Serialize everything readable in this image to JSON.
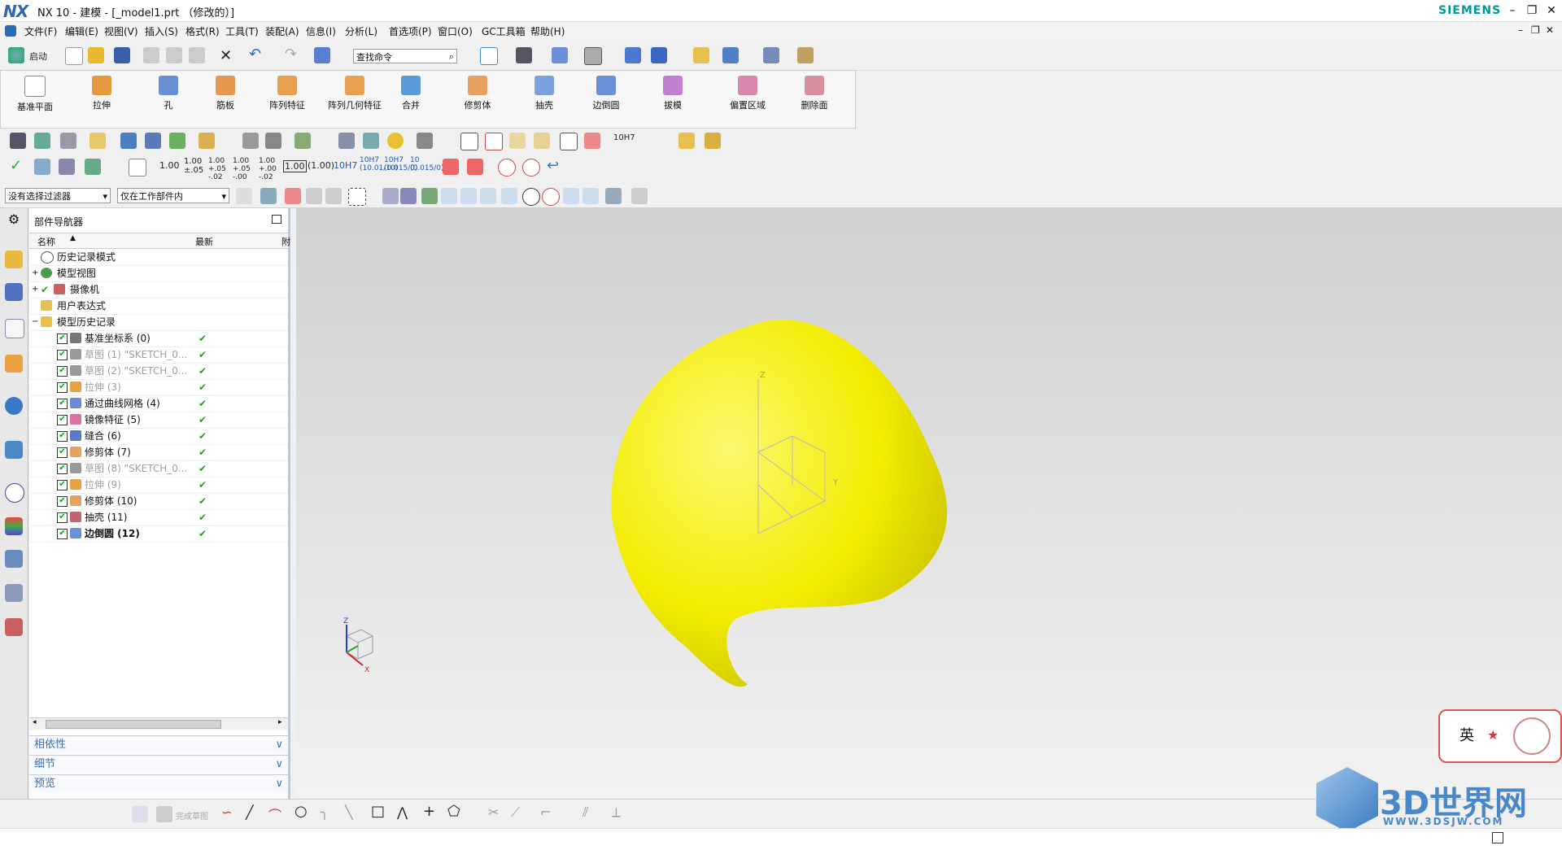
{
  "app": {
    "logo": "NX",
    "title": "NX 10 - 建模 - [_model1.prt （修改的）]",
    "brand": "SIEMENS"
  },
  "menu": [
    "文件(F)",
    "编辑(E)",
    "视图(V)",
    "插入(S)",
    "格式(R)",
    "工具(T)",
    "装配(A)",
    "信息(I)",
    "分析(L)",
    "首选项(P)",
    "窗口(O)",
    "GC工具箱",
    "帮助(H)"
  ],
  "toolbar": {
    "start_label": "启动",
    "search_placeholder": "查找命令"
  },
  "ribbon": [
    "基准平面",
    "拉伸",
    "孔",
    "筋板",
    "阵列特征",
    "阵列几何特征",
    "合并",
    "修剪体",
    "抽壳",
    "边倒圆",
    "拔模",
    "偏置区域",
    "删除面"
  ],
  "dimensions_row": [
    "1.00",
    "1.00 ±.05",
    "1.00 +.05 -.02",
    "1.00 +.05 -.00",
    "1.00 +.00 -.02",
    "1.00",
    "(1.00)",
    "10H7",
    "10H7 (10.01/10)",
    "10H7 (0.015/0)",
    "10 (0.015/0)"
  ],
  "fit_label": "10H7",
  "filters": {
    "selection_filter": "没有选择过滤器",
    "scope": "仅在工作部件内"
  },
  "navigator": {
    "title": "部件导航器",
    "col_name": "名称",
    "col_latest": "最新",
    "col_extra": "附",
    "rows": [
      {
        "label": "历史记录模式",
        "style": "normal"
      },
      {
        "label": "模型视图",
        "style": "normal"
      },
      {
        "label": "摄像机",
        "style": "normal"
      },
      {
        "label": "用户表达式",
        "style": "normal"
      },
      {
        "label": "模型历史记录",
        "style": "normal"
      },
      {
        "label": "基准坐标系 (0)",
        "style": "normal",
        "ok": "✔"
      },
      {
        "label": "草图 (1) \"SKETCH_0...",
        "style": "gray",
        "ok": "✔"
      },
      {
        "label": "草图 (2) \"SKETCH_0...",
        "style": "gray",
        "ok": "✔"
      },
      {
        "label": "拉伸 (3)",
        "style": "gray",
        "ok": "✔"
      },
      {
        "label": "通过曲线网格 (4)",
        "style": "normal",
        "ok": "✔"
      },
      {
        "label": "镜像特征 (5)",
        "style": "normal",
        "ok": "✔"
      },
      {
        "label": "缝合 (6)",
        "style": "normal",
        "ok": "✔"
      },
      {
        "label": "修剪体 (7)",
        "style": "normal",
        "ok": "✔"
      },
      {
        "label": "草图 (8) \"SKETCH_0...",
        "style": "gray",
        "ok": "✔"
      },
      {
        "label": "拉伸 (9)",
        "style": "gray",
        "ok": "✔"
      },
      {
        "label": "修剪体 (10)",
        "style": "normal",
        "ok": "✔"
      },
      {
        "label": "抽壳 (11)",
        "style": "normal",
        "ok": "✔"
      },
      {
        "label": "边倒圆 (12)",
        "style": "bold",
        "ok": "✔"
      }
    ],
    "panels": [
      "相依性",
      "细节",
      "预览"
    ]
  },
  "sketch_bar": {
    "finish_label": "完成草图"
  },
  "watermark": {
    "logo_text": "3D世界网",
    "url": "WWW.3DSJW.COM",
    "badge_char": "英"
  },
  "colors": {
    "model": "#f5f000",
    "accent": "#3a6fb0",
    "ok": "#2a9d2a"
  }
}
